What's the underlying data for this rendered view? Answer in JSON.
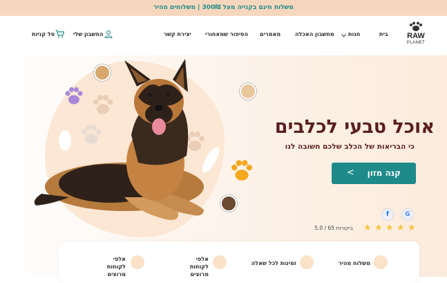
{
  "topbar": {
    "text": "משלוח חינם בקנייה מעל 300₪ | משלוחים מהיר"
  },
  "brand": {
    "line1": "RAW",
    "line2": "PLANET"
  },
  "nav": {
    "items": [
      "בית",
      "חנות",
      "מחשבון האכלה",
      "מאמרים",
      "הסיפור שמאחורי",
      "יצירת קשר"
    ],
    "account": "החשבון שלי",
    "cart": "סל קניות"
  },
  "hero": {
    "title": "אוכל טבעי לכלבים",
    "subtitle": "כי הבריאות של הכלב שלכם חשובה לנו",
    "cta_label": "קנה מזון",
    "cta_arrow": "<",
    "rating": "5.0 / 65 ביקורות",
    "stars": [
      "★",
      "★",
      "★",
      "★",
      "★"
    ],
    "review_sources": [
      "G",
      "f"
    ]
  },
  "features": {
    "items": [
      "משלוח מהיר",
      "זמינות לכל שאלה",
      "אלפי לקוחות מרוצים",
      "אלפי לקוחות מרוצים"
    ]
  },
  "colors": {
    "accent": "#1e8a8a",
    "title": "#5a1f1f",
    "topbar_bg": "#f6d7bd",
    "star": "#f5c542"
  }
}
